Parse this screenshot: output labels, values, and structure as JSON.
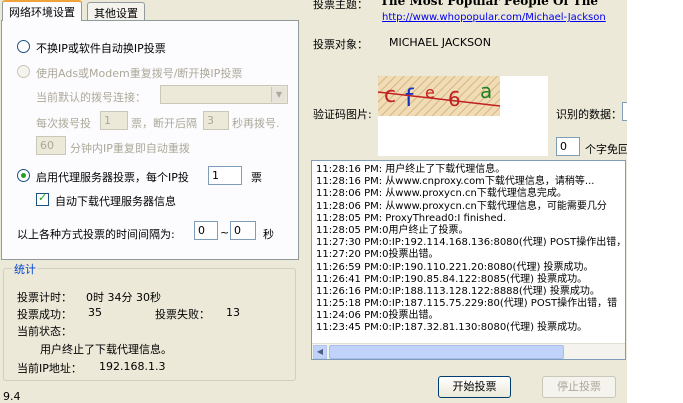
{
  "tabs": [
    {
      "label": "网络环境设置"
    },
    {
      "label": "其他设置"
    }
  ],
  "network": {
    "opt_no_change_ip": "不换IP或软件自动换IP投票",
    "opt_dialup": "使用Ads或Modem重复拨号/断开换IP投票",
    "default_dial_label": "当前默认的拨号连接：",
    "default_dial_value": "",
    "every_dial_label": "每次拨号投",
    "every_dial_value": "1",
    "every_dial_mid": "票，断开后隔",
    "redial_wait_value": "3",
    "redial_wait_suffix": "秒再拨号.",
    "minutes_value": "60",
    "minutes_suffix": "分钟内IP重复即自动重拨",
    "opt_proxy": "启用代理服务器投票，每个IP投",
    "proxy_votes_value": "1",
    "proxy_votes_suffix": "票",
    "auto_download_proxy": "自动下载代理服务器信息",
    "interval_label": "以上各种方式投票的时间间隔为:",
    "interval_from": "0",
    "interval_sep": "~",
    "interval_to": "0",
    "interval_unit": "秒"
  },
  "stats": {
    "title": "统计",
    "vote_timer_label": "投票计时：",
    "vote_timer_value": "0时 34分 30秒",
    "success_label": "投票成功：",
    "success_value": "35",
    "fail_label": "投票失败：",
    "fail_value": "13",
    "status_label": "当前状态：",
    "status_value": "用户终止了下载代理信息。",
    "ip_label": "当前IP地址：",
    "ip_value": "192.168.1.3"
  },
  "version": "9.4",
  "vote": {
    "topic_label": "投票主题：",
    "topic_value": "The Most Popular People Of The",
    "topic_url": "http://www.whopopular.com/Michael-Jackson",
    "target_label": "投票对象：",
    "target_value": "MICHAEL JACKSON",
    "captcha_label": "验证码图片:",
    "captcha_text": "cfe6a",
    "recognized_label": "识别的数据：",
    "recognized_value": "",
    "auto_value": "0",
    "auto_suffix": "个字免回"
  },
  "log_lines": [
    "11:28:16 PM: 用户终止了下载代理信息。",
    "11:28:16 PM: 从www.cnproxy.com下载代理信息，请稍等...",
    "11:28:06 PM: 从www.proxycn.cn下载代理信息完成。",
    "11:28:06 PM: 从www.proxycn.cn下载代理信息，可能需要几分",
    "11:28:05 PM: ProxyThread0:I finished.",
    "11:28:05 PM:0用户终止了投票。",
    "11:27:30 PM:0:IP:192.114.168.136:8080(代理) POST操作出错，",
    "11:27:20 PM:0投票出错。",
    "11:26:59 PM:0:IP:190.110.221.20:8080(代理) 投票成功。",
    "11:26:41 PM:0:IP:190.85.84.122:8085(代理) 投票成功。",
    "11:26:16 PM:0:IP:188.113.128.122:8888(代理) 投票成功。",
    "11:25:18 PM:0:IP:187.115.75.229:80(代理) POST操作出错，错",
    "11:24:06 PM:0投票出错。",
    "11:23:45 PM:0:IP:187.32.81.130:8080(代理) 投票成功。"
  ],
  "buttons": {
    "start": "开始投票",
    "stop": "停止投票"
  },
  "colors": {
    "window_bg": "#ece9d8",
    "tab_accent": "#f1a33b",
    "check_green": "#21a121",
    "group_title": "#0046d5"
  }
}
